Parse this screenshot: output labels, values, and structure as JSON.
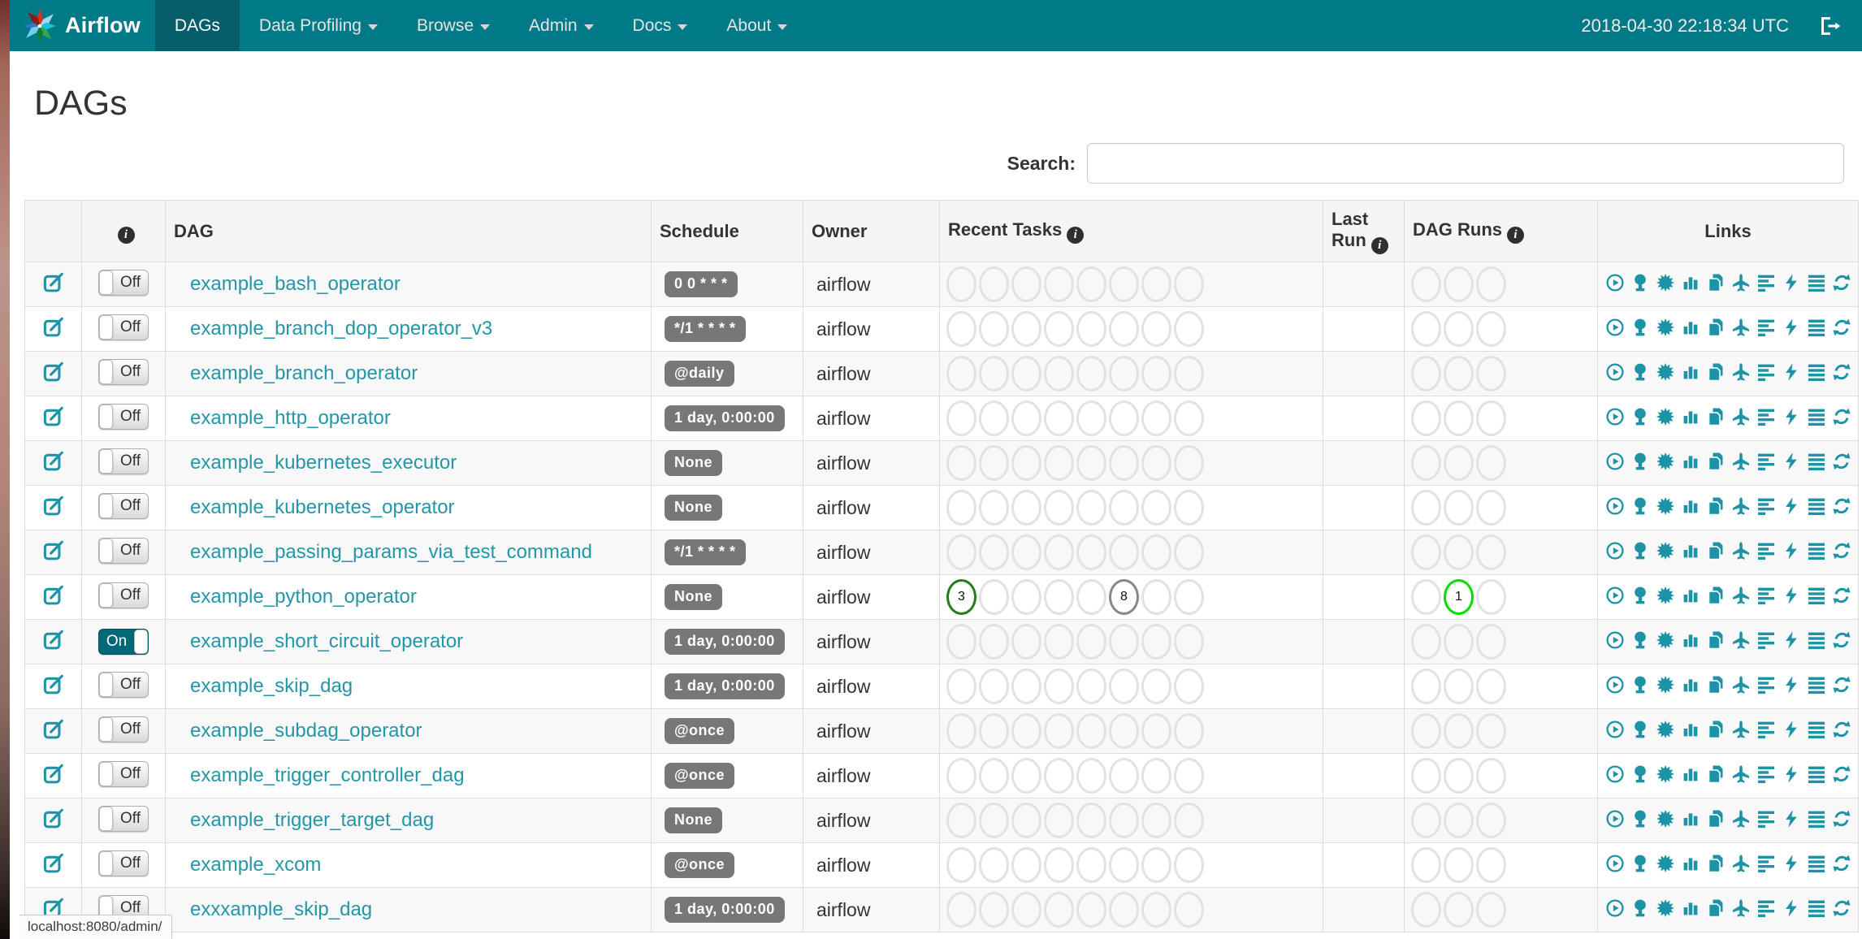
{
  "navbar": {
    "brand": "Airflow",
    "items": [
      {
        "label": "DAGs",
        "active": true,
        "caret": false
      },
      {
        "label": "Data Profiling",
        "active": false,
        "caret": true
      },
      {
        "label": "Browse",
        "active": false,
        "caret": true
      },
      {
        "label": "Admin",
        "active": false,
        "caret": true
      },
      {
        "label": "Docs",
        "active": false,
        "caret": true
      },
      {
        "label": "About",
        "active": false,
        "caret": true
      }
    ],
    "clock": "2018-04-30 22:18:34 UTC"
  },
  "page": {
    "title": "DAGs",
    "search_label": "Search:",
    "search_value": "",
    "status_bar": "localhost:8080/admin/"
  },
  "colors": {
    "navbar": "#007A87",
    "link": "#2396a8",
    "badge": "#777777",
    "state_success": "#1d801d",
    "state_none": "#888888",
    "state_running": "#00dd00",
    "circle_empty": "#e2e2e2"
  },
  "table": {
    "headers": [
      {
        "label": "",
        "info": false,
        "center": false
      },
      {
        "label": "",
        "info": true,
        "center": true
      },
      {
        "label": "DAG",
        "info": false,
        "center": false
      },
      {
        "label": "Schedule",
        "info": false,
        "center": false
      },
      {
        "label": "Owner",
        "info": false,
        "center": false
      },
      {
        "label": "Recent Tasks",
        "info": true,
        "center": false
      },
      {
        "label": "Last Run",
        "info": true,
        "center": false
      },
      {
        "label": "DAG Runs",
        "info": true,
        "center": false
      },
      {
        "label": "Links",
        "info": false,
        "center": true
      }
    ],
    "toggle_on_label": "On",
    "toggle_off_label": "Off",
    "recent_slots": 8,
    "run_slots": 3,
    "links": [
      {
        "key": "trigger-dag",
        "title": "Trigger Dag",
        "icon": "play-circle"
      },
      {
        "key": "tree-view",
        "title": "Tree View",
        "icon": "tree"
      },
      {
        "key": "graph-view",
        "title": "Graph View",
        "icon": "sunburst"
      },
      {
        "key": "task-duration",
        "title": "Task Duration",
        "icon": "bar-chart"
      },
      {
        "key": "task-tries",
        "title": "Task Tries",
        "icon": "duplicate"
      },
      {
        "key": "landing-times",
        "title": "Landing Times",
        "icon": "plane"
      },
      {
        "key": "gantt-view",
        "title": "Gantt View",
        "icon": "align-left"
      },
      {
        "key": "code-view",
        "title": "Code View",
        "icon": "flash"
      },
      {
        "key": "logs",
        "title": "Logs",
        "icon": "align-justify"
      },
      {
        "key": "refresh",
        "title": "Refresh",
        "icon": "refresh"
      }
    ],
    "rows": [
      {
        "name": "example_bash_operator",
        "schedule": "0 0 * * *",
        "owner": "airflow",
        "on": false,
        "recent": {},
        "runs": {}
      },
      {
        "name": "example_branch_dop_operator_v3",
        "schedule": "*/1 * * * *",
        "owner": "airflow",
        "on": false,
        "recent": {},
        "runs": {}
      },
      {
        "name": "example_branch_operator",
        "schedule": "@daily",
        "owner": "airflow",
        "on": false,
        "recent": {},
        "runs": {}
      },
      {
        "name": "example_http_operator",
        "schedule": "1 day, 0:00:00",
        "owner": "airflow",
        "on": false,
        "recent": {},
        "runs": {}
      },
      {
        "name": "example_kubernetes_executor",
        "schedule": "None",
        "owner": "airflow",
        "on": false,
        "recent": {},
        "runs": {}
      },
      {
        "name": "example_kubernetes_operator",
        "schedule": "None",
        "owner": "airflow",
        "on": false,
        "recent": {},
        "runs": {}
      },
      {
        "name": "example_passing_params_via_test_command",
        "schedule": "*/1 * * * *",
        "owner": "airflow",
        "on": false,
        "recent": {},
        "runs": {}
      },
      {
        "name": "example_python_operator",
        "schedule": "None",
        "owner": "airflow",
        "on": false,
        "recent": {
          "0": {
            "value": "3",
            "state": "success"
          },
          "5": {
            "value": "8",
            "state": "none"
          }
        },
        "runs": {
          "1": {
            "value": "1",
            "state": "running"
          }
        }
      },
      {
        "name": "example_short_circuit_operator",
        "schedule": "1 day, 0:00:00",
        "owner": "airflow",
        "on": true,
        "recent": {},
        "runs": {}
      },
      {
        "name": "example_skip_dag",
        "schedule": "1 day, 0:00:00",
        "owner": "airflow",
        "on": false,
        "recent": {},
        "runs": {}
      },
      {
        "name": "example_subdag_operator",
        "schedule": "@once",
        "owner": "airflow",
        "on": false,
        "recent": {},
        "runs": {}
      },
      {
        "name": "example_trigger_controller_dag",
        "schedule": "@once",
        "owner": "airflow",
        "on": false,
        "recent": {},
        "runs": {}
      },
      {
        "name": "example_trigger_target_dag",
        "schedule": "None",
        "owner": "airflow",
        "on": false,
        "recent": {},
        "runs": {}
      },
      {
        "name": "example_xcom",
        "schedule": "@once",
        "owner": "airflow",
        "on": false,
        "recent": {},
        "runs": {}
      },
      {
        "name": "exxxample_skip_dag",
        "schedule": "1 day, 0:00:00",
        "owner": "airflow",
        "on": false,
        "recent": {},
        "runs": {}
      }
    ]
  }
}
